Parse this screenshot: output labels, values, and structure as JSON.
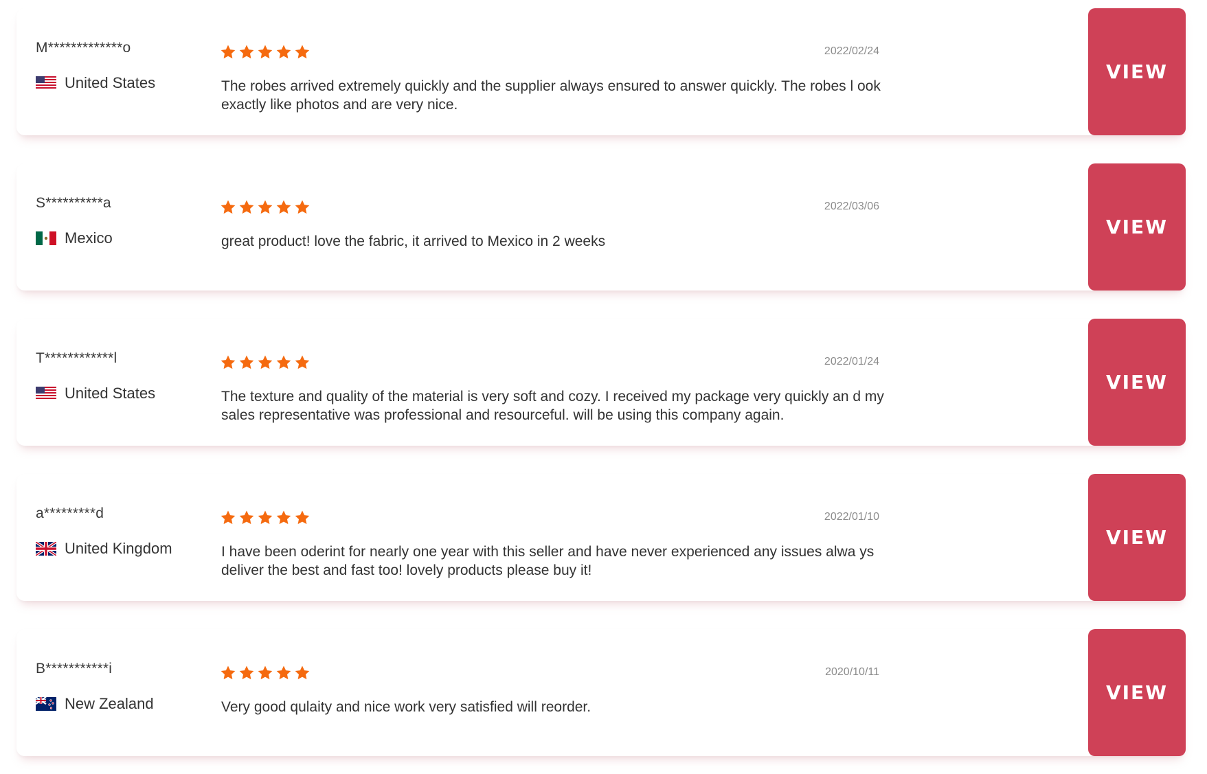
{
  "colors": {
    "accent": "#cf4157",
    "star": "#f56a0f",
    "date": "#8c8c8c",
    "text": "#333333"
  },
  "reviews": [
    {
      "name": "M*************o",
      "country": "United States",
      "flag": "us-flag-icon",
      "rating": 5,
      "date": "2022/02/24",
      "text": "The robes arrived extremely quickly and the supplier always ensured to answer quickly. The robes l ook exactly like photos and are very nice.",
      "button": "VIEW"
    },
    {
      "name": "S**********a",
      "country": "Mexico",
      "flag": "mx-flag-icon",
      "rating": 5,
      "date": "2022/03/06",
      "text": "great product! love the fabric, it arrived to Mexico in 2 weeks",
      "button": "VIEW"
    },
    {
      "name": "T************l",
      "country": "United States",
      "flag": "us-flag-icon",
      "rating": 5,
      "date": "2022/01/24",
      "text": "The texture and quality of the material is very soft and cozy. I received my package very quickly an d my sales representative was professional and resourceful. will be using this company again.",
      "button": "VIEW"
    },
    {
      "name": "a*********d",
      "country": "United Kingdom",
      "flag": "uk-flag-icon",
      "rating": 5,
      "date": "2022/01/10",
      "text": "I have been oderint for nearly one year with this seller and have never experienced any issues alwa ys deliver the best and fast too! lovely products please buy it!",
      "button": "VIEW"
    },
    {
      "name": "B***********i",
      "country": "New Zealand",
      "flag": "nz-flag-icon",
      "rating": 5,
      "date": "2020/10/11",
      "text": "Very good qulaity and nice work very satisfied will reorder.",
      "button": "VIEW"
    }
  ]
}
